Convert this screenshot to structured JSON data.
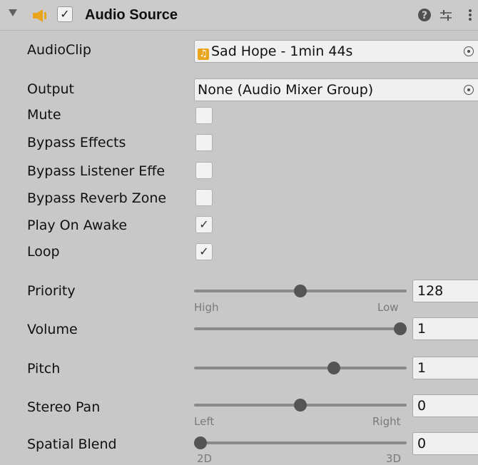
{
  "component": {
    "title": "Audio Source",
    "enabled": true,
    "icon_names": [
      "foldout-arrow-icon",
      "audio-source-icon",
      "help-icon",
      "presets-icon",
      "menu-icon"
    ]
  },
  "fields": {
    "audioclip": {
      "label": "AudioClip",
      "value": "Sad Hope - 1min 44s",
      "icon": "music-note-icon"
    },
    "output": {
      "label": "Output",
      "value": "None (Audio Mixer Group)"
    }
  },
  "toggles": {
    "mute": {
      "label": "Mute",
      "checked": false
    },
    "bypass_effects": {
      "label": "Bypass Effects",
      "checked": false
    },
    "bypass_listener": {
      "label": "Bypass Listener Effe",
      "checked": false
    },
    "bypass_reverb": {
      "label": "Bypass Reverb Zone",
      "checked": false
    },
    "play_on_awake": {
      "label": "Play On Awake",
      "checked": true,
      "mark": "✓"
    },
    "loop": {
      "label": "Loop",
      "checked": true,
      "mark": "✓"
    }
  },
  "sliders": {
    "priority": {
      "label": "Priority",
      "value": "128",
      "min": 0,
      "max": 256,
      "left_label": "High",
      "right_label": "Low"
    },
    "volume": {
      "label": "Volume",
      "value": "1",
      "min": 0,
      "max": 1
    },
    "pitch": {
      "label": "Pitch",
      "value": "1",
      "min": -3,
      "max": 3
    },
    "stereo_pan": {
      "label": "Stereo Pan",
      "value": "0",
      "min": -1,
      "max": 1,
      "left_label": "Left",
      "right_label": "Right"
    },
    "spatial_blend": {
      "label": "Spatial Blend",
      "value": "0",
      "min": 0,
      "max": 1,
      "left_label": "2D",
      "right_label": "3D"
    }
  },
  "colors": {
    "background": "#c8c8c8",
    "accent": "#e9a51d"
  }
}
